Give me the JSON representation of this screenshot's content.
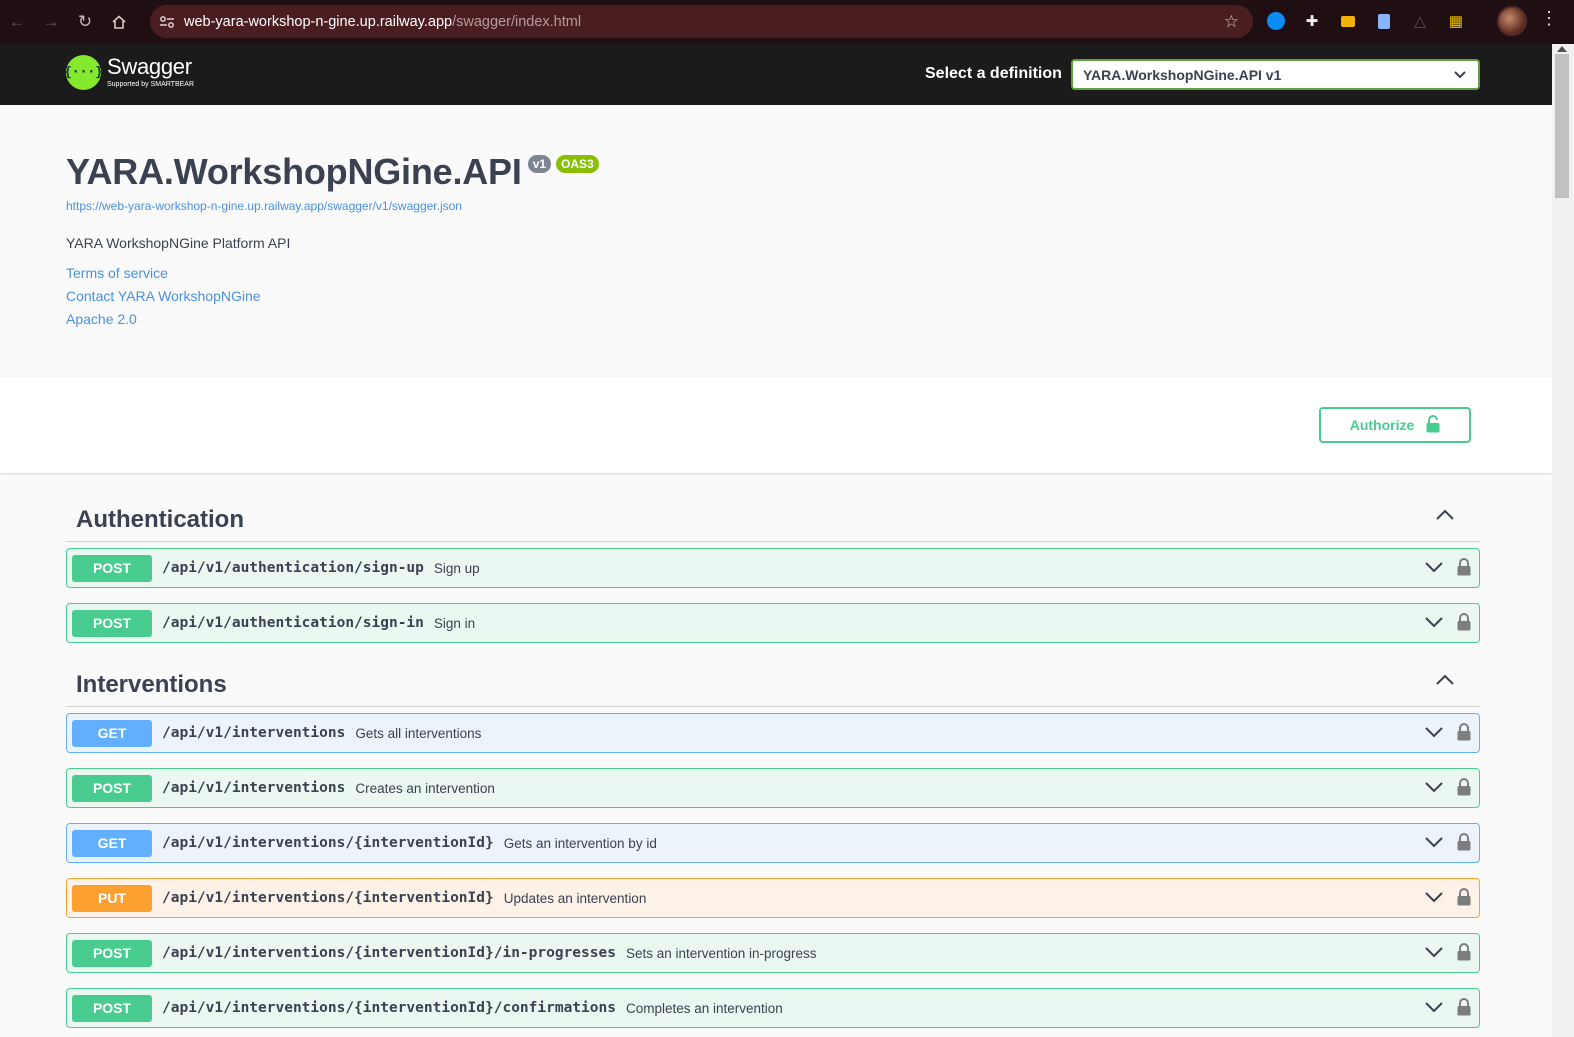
{
  "browser": {
    "url_host": "web-yara-workshop-n-gine.up.railway.app",
    "url_path": "/swagger/index.html"
  },
  "topbar": {
    "logo_word": "Swagger",
    "logo_sub": "Supported by SMARTBEAR",
    "definition_label": "Select a definition",
    "definition_value": "YARA.WorkshopNGine.API v1"
  },
  "info": {
    "title": "YARA.WorkshopNGine.API",
    "version_badge": "v1",
    "oas_badge": "OAS3",
    "spec_url": "https://web-yara-workshop-n-gine.up.railway.app/swagger/v1/swagger.json",
    "description": "YARA WorkshopNGine Platform API",
    "terms": "Terms of service",
    "contact": "Contact YARA WorkshopNGine",
    "license": "Apache 2.0"
  },
  "auth": {
    "authorize_label": "Authorize"
  },
  "tags": [
    {
      "name": "Authentication",
      "operations": [
        {
          "method": "POST",
          "path": "/api/v1/authentication/sign-up",
          "summary": "Sign up"
        },
        {
          "method": "POST",
          "path": "/api/v1/authentication/sign-in",
          "summary": "Sign in"
        }
      ]
    },
    {
      "name": "Interventions",
      "operations": [
        {
          "method": "GET",
          "path": "/api/v1/interventions",
          "summary": "Gets all interventions"
        },
        {
          "method": "POST",
          "path": "/api/v1/interventions",
          "summary": "Creates an intervention"
        },
        {
          "method": "GET",
          "path": "/api/v1/interventions/{interventionId}",
          "summary": "Gets an intervention by id"
        },
        {
          "method": "PUT",
          "path": "/api/v1/interventions/{interventionId}",
          "summary": "Updates an intervention"
        },
        {
          "method": "POST",
          "path": "/api/v1/interventions/{interventionId}/in-progresses",
          "summary": "Sets an intervention in-progress"
        },
        {
          "method": "POST",
          "path": "/api/v1/interventions/{interventionId}/confirmations",
          "summary": "Completes an intervention"
        }
      ]
    }
  ],
  "colors": {
    "post": "#49cc90",
    "get": "#61affe",
    "put": "#fca130",
    "link": "#4990e2",
    "swagger_green": "#85ea2d"
  }
}
